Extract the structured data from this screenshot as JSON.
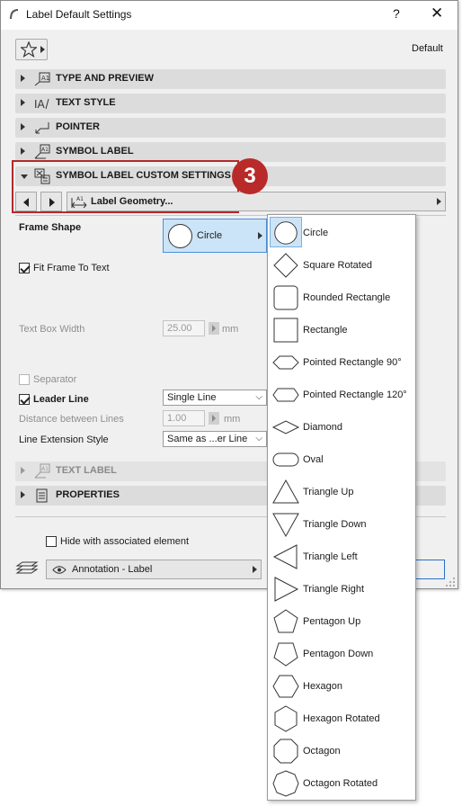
{
  "window": {
    "title": "Label Default Settings",
    "help": "?",
    "close": "✕"
  },
  "toolbar": {
    "default_label": "Default",
    "favorites_icon": "star-icon"
  },
  "panels": [
    {
      "label": "TYPE AND PREVIEW",
      "expanded": false
    },
    {
      "label": "TEXT STYLE",
      "expanded": false
    },
    {
      "label": "POINTER",
      "expanded": false
    },
    {
      "label": "SYMBOL LABEL",
      "expanded": false
    },
    {
      "label": "SYMBOL LABEL CUSTOM SETTINGS",
      "expanded": true
    },
    {
      "label": "TEXT LABEL",
      "expanded": false,
      "disabled": true
    },
    {
      "label": "PROPERTIES",
      "expanded": false
    }
  ],
  "callout": {
    "number": "3",
    "color": "#b92b2a"
  },
  "page_selector": {
    "label": "Label Geometry..."
  },
  "fields": {
    "frame_shape": {
      "label": "Frame Shape",
      "value": "Circle"
    },
    "fit_frame": {
      "label": "Fit Frame To Text",
      "checked": true
    },
    "text_box_width": {
      "label": "Text Box Width",
      "value": "25.00",
      "unit": "mm"
    },
    "separator": {
      "label": "Separator",
      "checked": false
    },
    "leader_line": {
      "label": "Leader Line",
      "checked": true,
      "value": "Single Line"
    },
    "distance_lines": {
      "label": "Distance between Lines",
      "value": "1.00",
      "unit": "mm"
    },
    "line_extension": {
      "label": "Line Extension Style",
      "value": "Same as ...er Line"
    }
  },
  "footer": {
    "hide_label": "Hide with associated element",
    "layer_value": "Annotation - Label"
  },
  "shape_menu": {
    "selected": "Circle",
    "items": [
      {
        "label": "Circle",
        "shape": "circle"
      },
      {
        "label": "Square Rotated",
        "shape": "diamond-square"
      },
      {
        "label": "Rounded Rectangle",
        "shape": "rounded-rect"
      },
      {
        "label": "Rectangle",
        "shape": "rect"
      },
      {
        "label": "Pointed Rectangle 90°",
        "shape": "pointed-90"
      },
      {
        "label": "Pointed Rectangle 120°",
        "shape": "pointed-120"
      },
      {
        "label": "Diamond",
        "shape": "diamond"
      },
      {
        "label": "Oval",
        "shape": "oval"
      },
      {
        "label": "Triangle Up",
        "shape": "tri-up"
      },
      {
        "label": "Triangle Down",
        "shape": "tri-down"
      },
      {
        "label": "Triangle Left",
        "shape": "tri-left"
      },
      {
        "label": "Triangle Right",
        "shape": "tri-right"
      },
      {
        "label": "Pentagon Up",
        "shape": "pent-up"
      },
      {
        "label": "Pentagon Down",
        "shape": "pent-down"
      },
      {
        "label": "Hexagon",
        "shape": "hex"
      },
      {
        "label": "Hexagon Rotated",
        "shape": "hex-rot"
      },
      {
        "label": "Octagon",
        "shape": "oct"
      },
      {
        "label": "Octagon Rotated",
        "shape": "oct-rot"
      }
    ]
  }
}
